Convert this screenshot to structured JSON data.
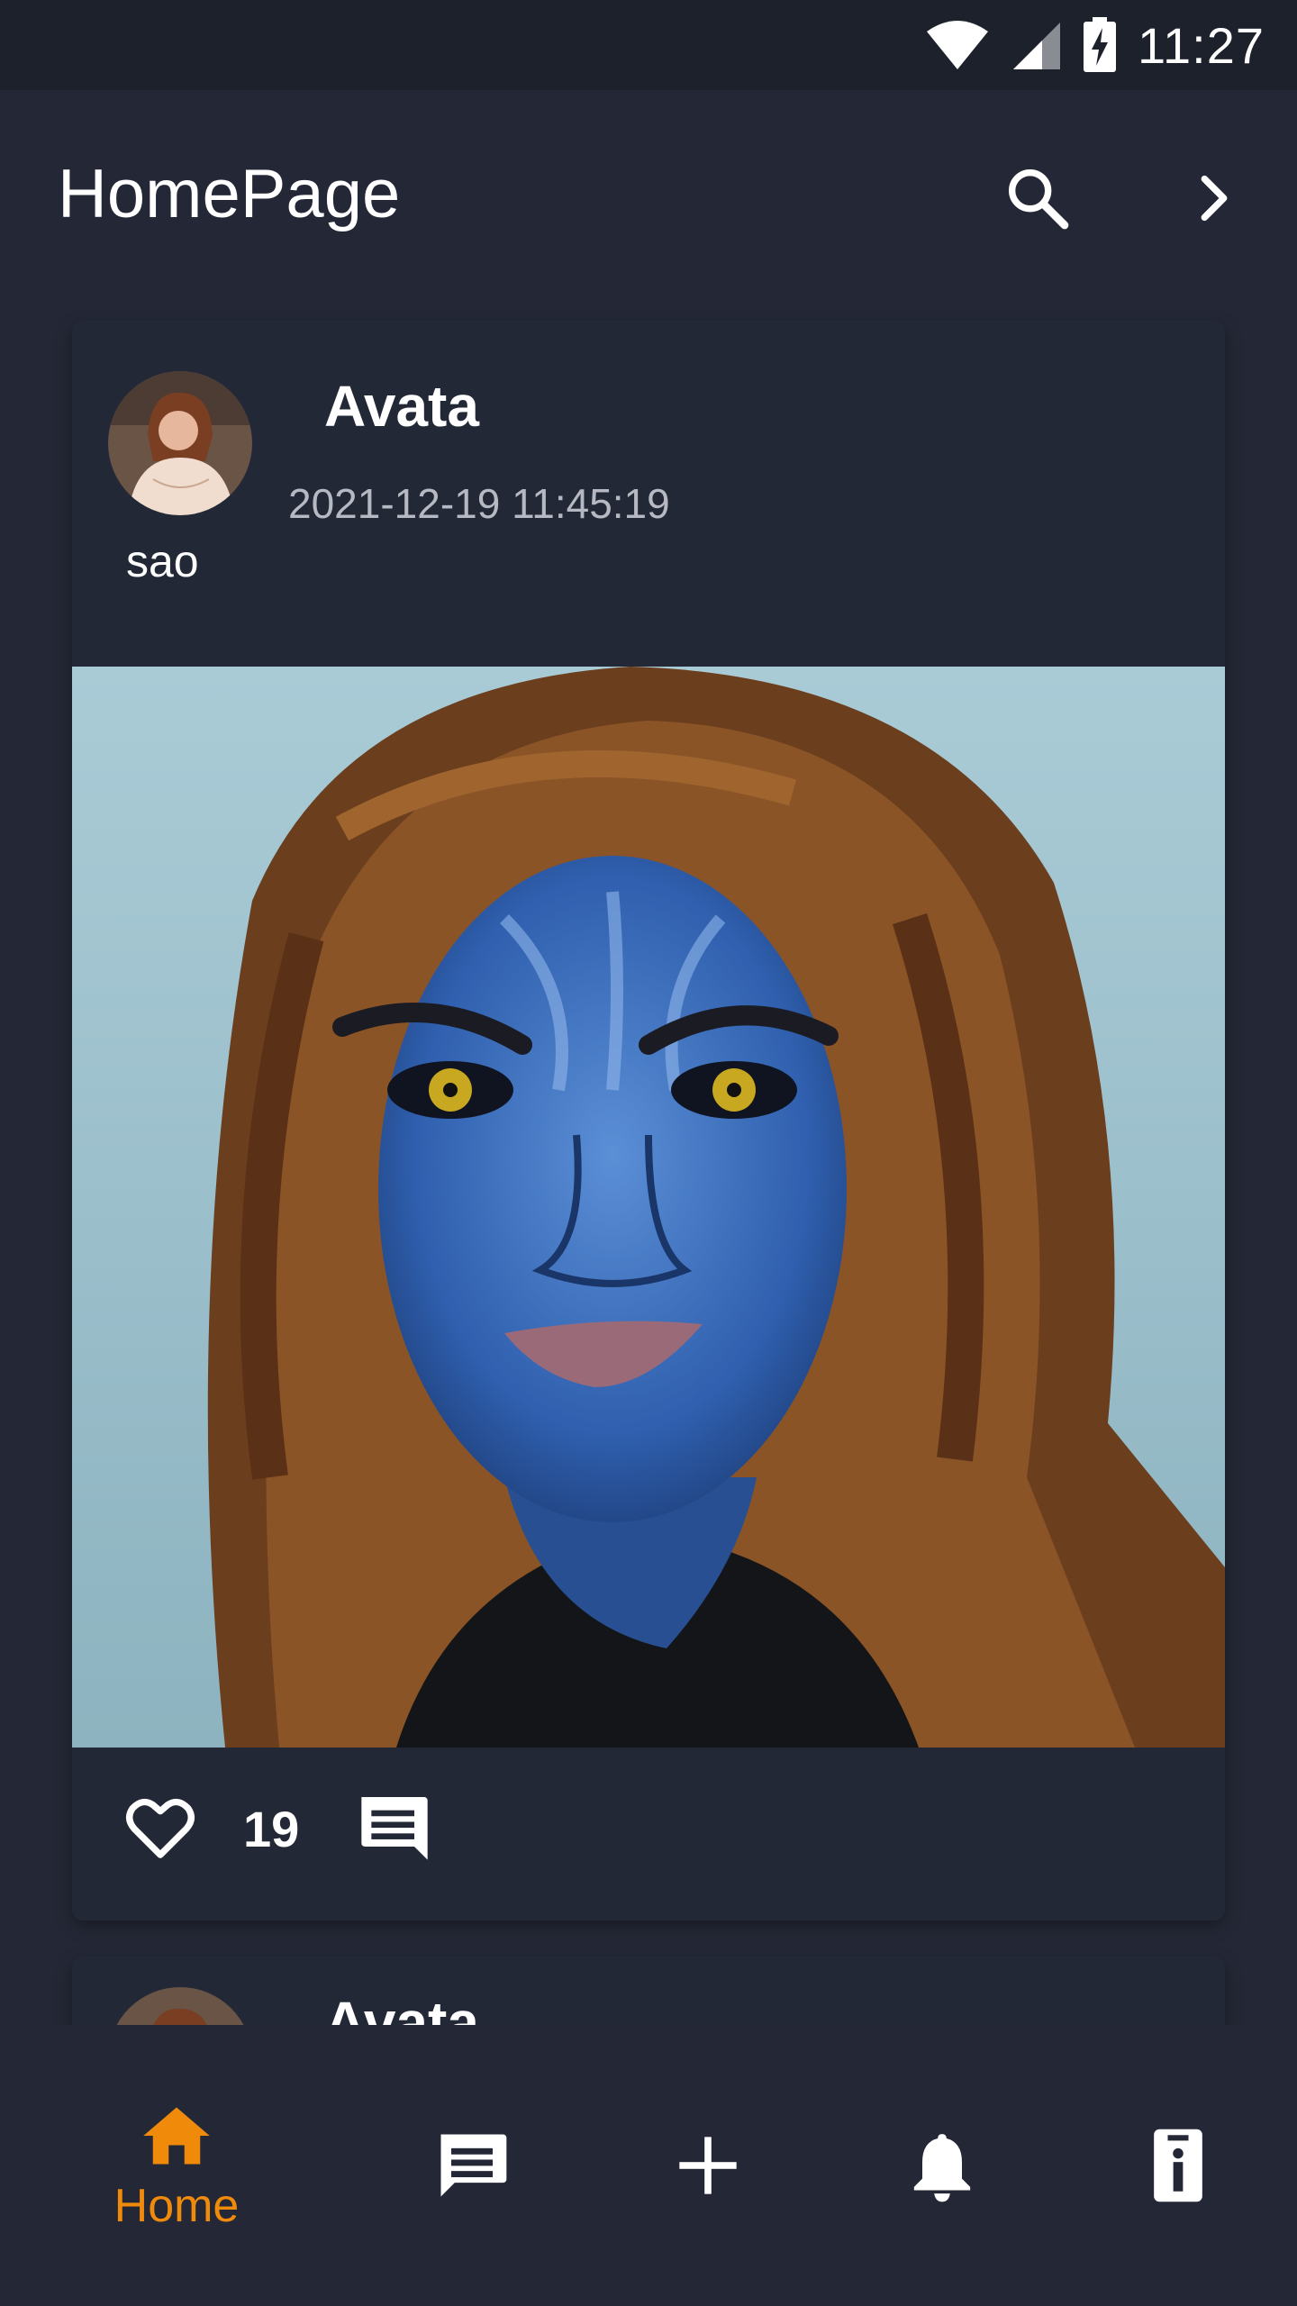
{
  "status_bar": {
    "time": "11:27",
    "icons": [
      "wifi-icon",
      "cellular-signal-icon",
      "battery-charging-icon"
    ]
  },
  "app_bar": {
    "title": "HomePage",
    "actions": [
      "search-icon",
      "chevron-right-icon"
    ]
  },
  "feed": {
    "posts": [
      {
        "title": "Avata",
        "date": "2021-12-19 11:45:19",
        "username": "sao",
        "likes": "19",
        "icons": [
          "avatar-photo",
          "post-photo",
          "heart-outline-icon",
          "comment-icon"
        ]
      },
      {
        "title": "Avata",
        "partial": true
      }
    ]
  },
  "bottom_nav": {
    "items": [
      {
        "icon": "home-icon",
        "label": "Home",
        "active": true
      },
      {
        "icon": "chat-icon",
        "label": ""
      },
      {
        "icon": "add-icon",
        "label": ""
      },
      {
        "icon": "bell-icon",
        "label": ""
      },
      {
        "icon": "info-icon",
        "label": ""
      }
    ]
  },
  "colors": {
    "background": "#242836",
    "status_bar": "#1d212c",
    "card": "#232837",
    "accent": "#f08a0b",
    "muted_text": "#b7b9c2"
  }
}
